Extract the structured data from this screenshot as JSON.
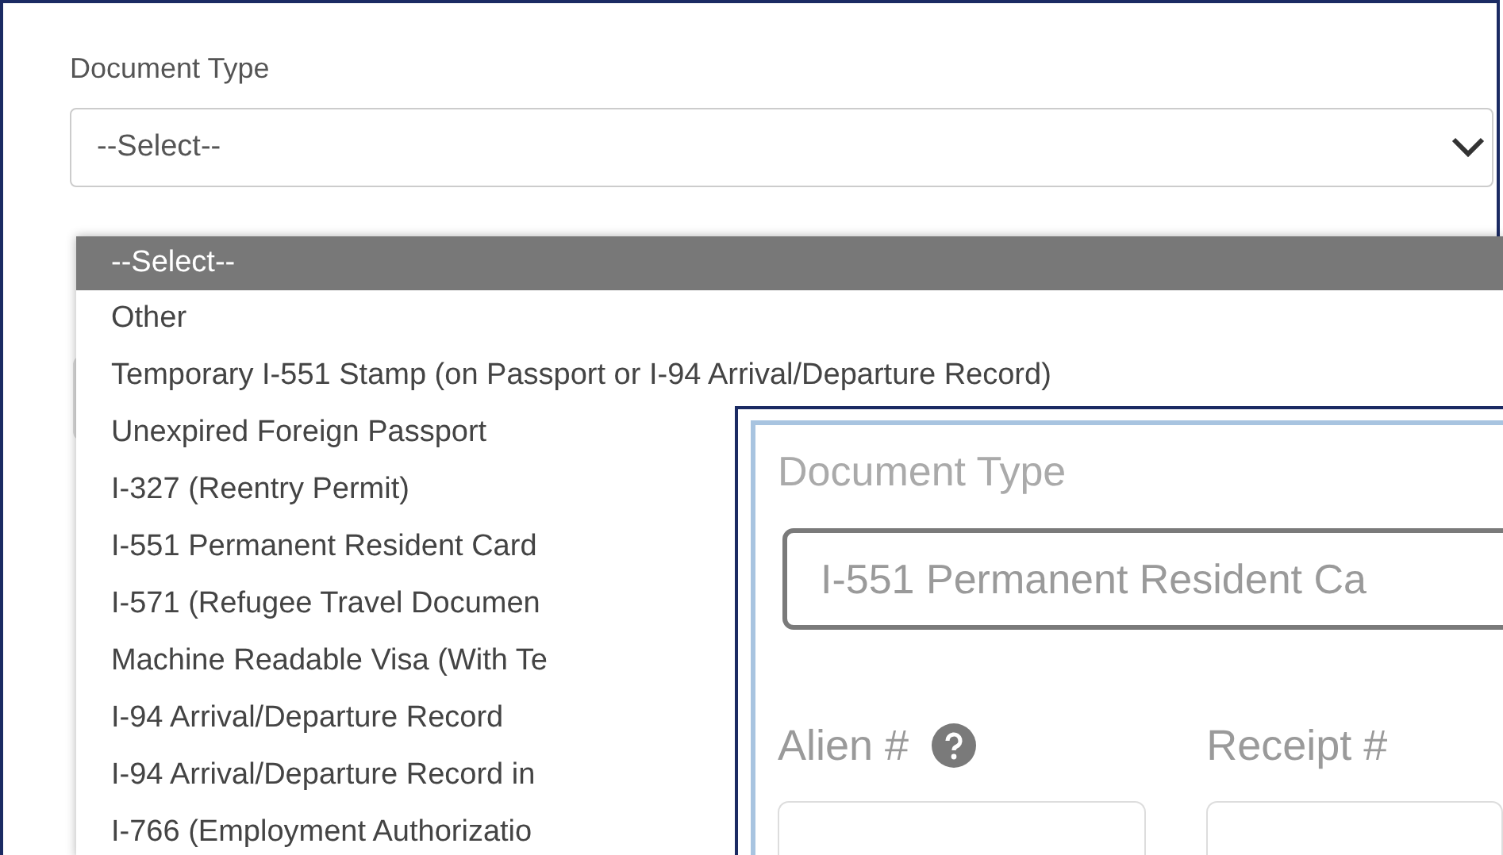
{
  "back_form": {
    "label": "Document Type",
    "select": {
      "value": "--Select--"
    },
    "dropdown": {
      "options": [
        {
          "label": "--Select--",
          "selected": true
        },
        {
          "label": "Other",
          "selected": false
        },
        {
          "label": "Temporary I-551 Stamp (on Passport or I-94 Arrival/Departure Record)",
          "selected": false
        },
        {
          "label": "Unexpired Foreign Passport",
          "selected": false
        },
        {
          "label": "I-327 (Reentry Permit)",
          "selected": false
        },
        {
          "label": "I-551 Permanent Resident Card",
          "selected": false
        },
        {
          "label": "I-571 (Refugee Travel Documen",
          "selected": false
        },
        {
          "label": "Machine Readable Visa (With Te",
          "selected": false
        },
        {
          "label": "I-94 Arrival/Departure Record",
          "selected": false
        },
        {
          "label": "I-94 Arrival/Departure Record in",
          "selected": false
        },
        {
          "label": "I-766 (Employment Authorizatio",
          "selected": false
        }
      ]
    }
  },
  "front_form": {
    "label": "Document Type",
    "select": {
      "value": "I-551 Permanent Resident Ca"
    },
    "fields": [
      {
        "label": "Alien #",
        "help": true
      },
      {
        "label": "Receipt #",
        "help": false
      }
    ]
  }
}
